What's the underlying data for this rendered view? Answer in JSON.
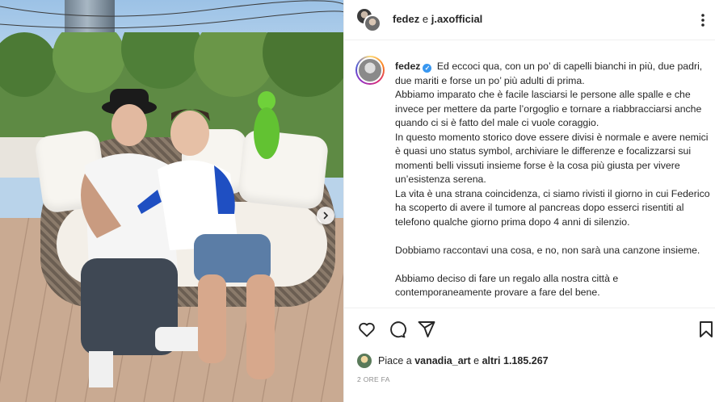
{
  "header": {
    "user1": "fedez",
    "connector": "e",
    "user2": "j.axofficial"
  },
  "post": {
    "author": "fedez",
    "caption_lines": [
      "Ed eccoci qua, con un po’ di capelli bianchi in più, due padri, due mariti e forse un po’ più adulti di prima.",
      "Abbiamo imparato che è facile lasciarsi le persone alle spalle e che invece per mettere da parte l’orgoglio e tornare a riabbracciarsi anche quando ci si è fatto del male ci vuole coraggio.",
      "In questo momento storico dove essere divisi è normale e avere nemici è quasi uno status symbol, archiviare le differenze e focalizzarsi sui momenti belli vissuti insieme forse è la cosa più giusta per vivere un’esistenza serena.",
      "La vita è una strana coincidenza, ci siamo rivisti il giorno in cui Federico ha scoperto di avere il tumore al pancreas dopo esserci risentiti al telefono qualche giorno prima dopo 4 anni di silenzio.",
      "",
      "Dobbiamo raccontavi una cosa, e no, non sarà una canzone insieme.",
      "",
      "Abbiamo deciso di fare un regalo alla nostra città e contemporaneamente provare a fare del bene."
    ]
  },
  "likes": {
    "prefix": "Piace a",
    "user": "vanadia_art",
    "middle": "e",
    "count": "altri 1.185.267"
  },
  "timestamp": "2 ORE FA",
  "icons": {
    "like": "heart-icon",
    "comment": "comment-icon",
    "share": "paper-plane-icon",
    "save": "bookmark-icon",
    "more": "more-vertical-icon",
    "next": "chevron-right-icon",
    "verified": "verified-badge-icon"
  },
  "colors": {
    "verified": "#3897f0",
    "text": "#262626",
    "muted": "#8e8e8e",
    "divider": "#efefef"
  }
}
